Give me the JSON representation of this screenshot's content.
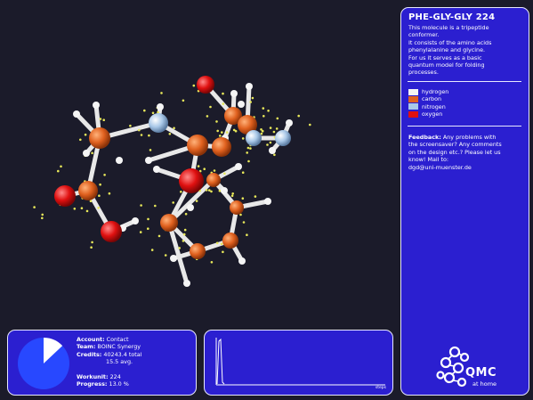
{
  "molecule": {
    "title": "PHE-GLY-GLY 224",
    "description_lines": [
      "This molecule is a tripeptide",
      "conformer.",
      "It consists of the amino acids",
      "phenylalanine and glycine.",
      "For us it serves as a basic",
      "quantum model for folding",
      "processes."
    ]
  },
  "legend": [
    {
      "label": "hydrogen",
      "color": "#f5f5f5"
    },
    {
      "label": "carbon",
      "color": "#e0611f"
    },
    {
      "label": "nitrogen",
      "color": "#a9c8e8"
    },
    {
      "label": "oxygen",
      "color": "#e01010"
    }
  ],
  "feedback": {
    "label": "Feedback:",
    "first_line_rest": " Any problems with",
    "lines": [
      "the screensaver? Any comments",
      "on the design etc.? Please let us",
      "know! Mail to:",
      "dgd@uni-muenster.de"
    ]
  },
  "logo": {
    "name": "QMC",
    "subtitle": "at home"
  },
  "stats": {
    "account_label": "Account:",
    "account_value": "Contact",
    "team_label": "Team:",
    "team_value": "BOINC Synergy",
    "credits_label": "Credits:",
    "credits_total": "40243.4 total",
    "credits_avg": "15.5 avg.",
    "workunit_label": "Workunit:",
    "workunit_value": "224",
    "progress_label": "Progress:",
    "progress_value": "13.0 %",
    "progress_fraction": 0.13
  },
  "graph": {
    "xlabel": "steps"
  },
  "colors": {
    "panel": "#2b1fd0",
    "border": "#e8e8ff",
    "background": "#1b1b2a",
    "pie": "#2848ff"
  }
}
